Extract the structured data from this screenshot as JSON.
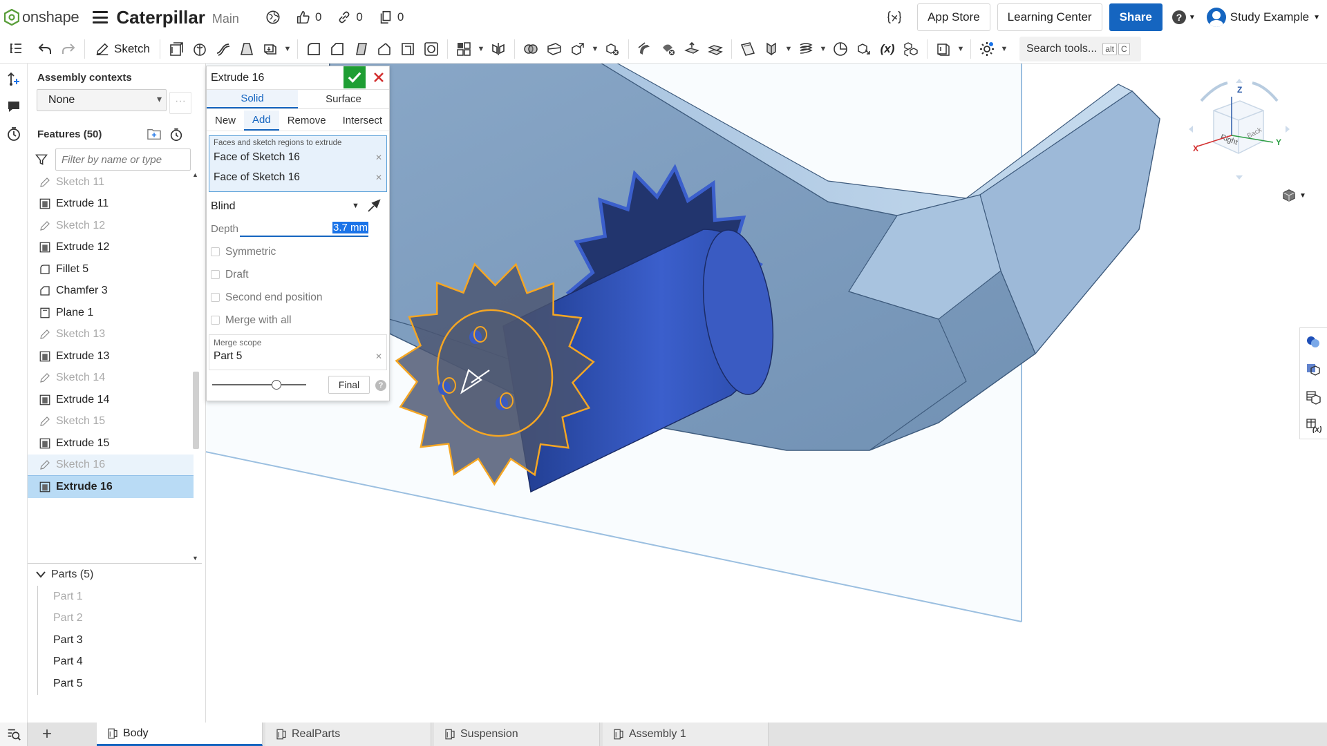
{
  "app": {
    "brand": "onshape",
    "doc_title": "Caterpillar",
    "workspace": "Main"
  },
  "topbar": {
    "likes": "0",
    "links": "0",
    "copies": "0",
    "app_store": "App Store",
    "learning_center": "Learning Center",
    "share": "Share",
    "user_name": "Study Example"
  },
  "toolbar": {
    "sketch_label": "Sketch",
    "search_placeholder": "Search tools...",
    "search_key_alt": "alt",
    "search_key_c": "C"
  },
  "assembly_contexts": {
    "title": "Assembly contexts",
    "selected": "None",
    "more": "···"
  },
  "features": {
    "title": "Features (50)",
    "filter_placeholder": "Filter by name or type",
    "items": [
      {
        "label": "Sketch 11",
        "type": "sketch"
      },
      {
        "label": "Extrude 11",
        "type": "extrude"
      },
      {
        "label": "Sketch 12",
        "type": "sketch"
      },
      {
        "label": "Extrude 12",
        "type": "extrude"
      },
      {
        "label": "Fillet 5",
        "type": "fillet"
      },
      {
        "label": "Chamfer 3",
        "type": "chamfer"
      },
      {
        "label": "Plane 1",
        "type": "plane"
      },
      {
        "label": "Sketch 13",
        "type": "sketch"
      },
      {
        "label": "Extrude 13",
        "type": "extrude"
      },
      {
        "label": "Sketch 14",
        "type": "sketch"
      },
      {
        "label": "Extrude 14",
        "type": "extrude"
      },
      {
        "label": "Sketch 15",
        "type": "sketch"
      },
      {
        "label": "Extrude 15",
        "type": "extrude"
      },
      {
        "label": "Sketch 16",
        "type": "sketch"
      },
      {
        "label": "Extrude 16",
        "type": "extrude"
      }
    ]
  },
  "parts": {
    "title": "Parts (5)",
    "items": [
      "Part 1",
      "Part 2",
      "Part 3",
      "Part 4",
      "Part 5"
    ]
  },
  "extrude_dialog": {
    "title": "Extrude 16",
    "body_types": [
      "Solid",
      "Surface"
    ],
    "operations": [
      "New",
      "Add",
      "Remove",
      "Intersect"
    ],
    "selection_label": "Faces and sketch regions to extrude",
    "selections": [
      "Face of Sketch 16",
      "Face of Sketch 16"
    ],
    "end_type": "Blind",
    "depth_label": "Depth",
    "depth_value": "3.7 mm",
    "options": [
      "Symmetric",
      "Draft",
      "Second end position",
      "Merge with all"
    ],
    "merge_scope_label": "Merge scope",
    "merge_scope_value": "Part 5",
    "final_label": "Final",
    "help": "?"
  },
  "viewcube": {
    "z": "Z",
    "x": "X",
    "y": "Y",
    "right": "Right",
    "back": "Back"
  },
  "bottom_tabs": [
    "Body",
    "RealParts",
    "Suspension",
    "Assembly 1"
  ],
  "colors": {
    "accent": "#1565c0",
    "confirm": "#1e9e33",
    "cancel": "#d32f2f",
    "part_light": "#8fb0d2",
    "gear_dark": "#22356e",
    "highlight": "#f5a623"
  }
}
